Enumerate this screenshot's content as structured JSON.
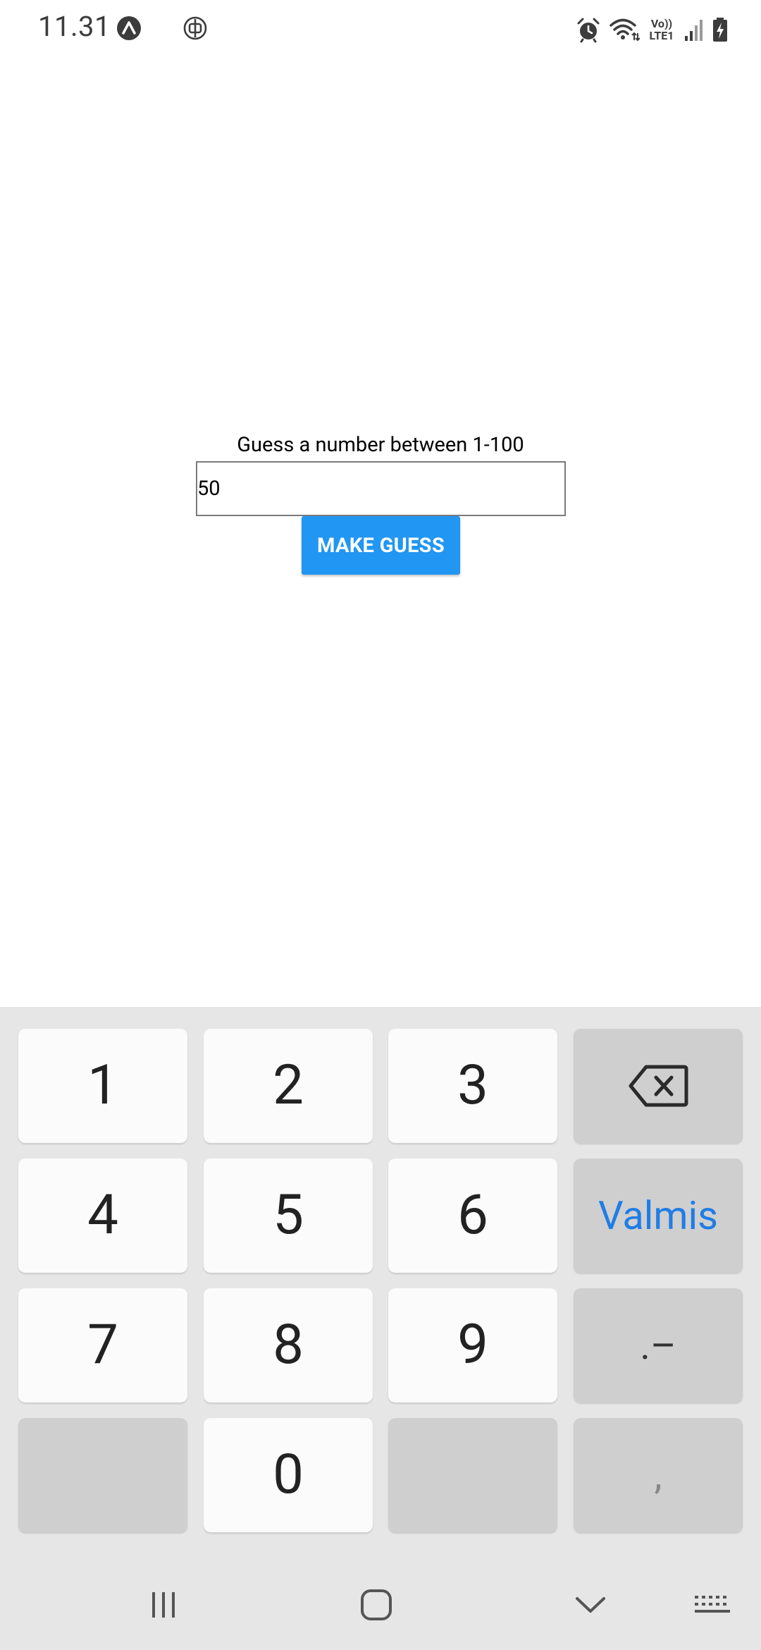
{
  "status_bar": {
    "time": "11.31",
    "left_icons": [
      "expo-icon",
      "vpn-icon"
    ],
    "right_icons": [
      "alarm-icon",
      "wifi-icon",
      "volte-icon",
      "signal-icon",
      "battery-charging-icon"
    ],
    "volte_text_top": "Vo))",
    "volte_text_bottom": "LTE1"
  },
  "content": {
    "label": "Guess a number between 1-100",
    "input_value": "50",
    "button_label": "MAKE GUESS",
    "accent_color": "#2196f3"
  },
  "keyboard": {
    "keys": {
      "k1": "1",
      "k2": "2",
      "k3": "3",
      "k4": "4",
      "k5": "5",
      "k6": "6",
      "k7": "7",
      "k8": "8",
      "k9": "9",
      "k0": "0",
      "done": "Valmis",
      "dot_dash": ".–",
      "comma": ","
    },
    "done_color": "#1f7de6"
  },
  "nav_bar": {
    "items": [
      "recent-apps-icon",
      "home-icon",
      "back-icon",
      "keyboard-icon"
    ]
  }
}
